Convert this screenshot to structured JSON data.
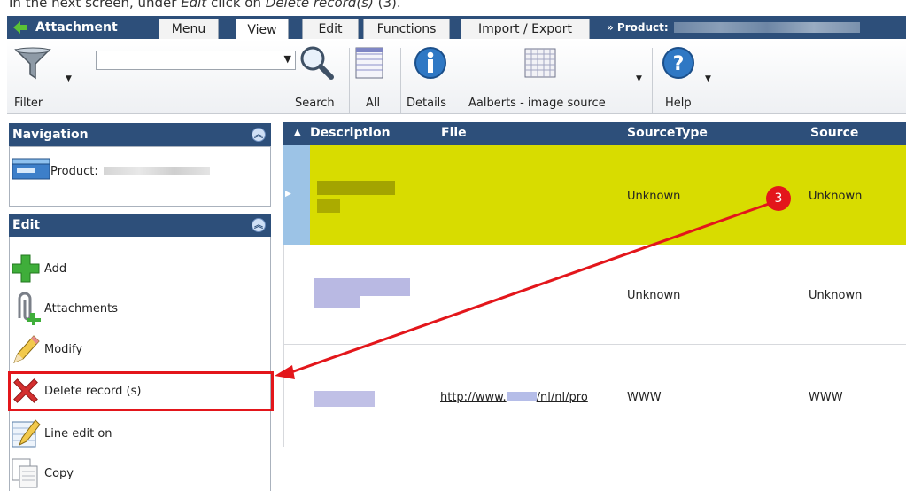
{
  "caption": {
    "prefix": "In the next screen, under ",
    "edit": "Edit",
    "mid": " click on ",
    "action": "Delete record(s)",
    "suffix": " (3)."
  },
  "tabs": {
    "app_label": "Attachment",
    "items": [
      "Menu",
      "View",
      "Edit",
      "Functions",
      "Import / Export"
    ],
    "breadcrumb": "» Product:"
  },
  "toolbar": {
    "filter_label": "Filter",
    "search_label": "Search",
    "all_label": "All",
    "details_label": "Details",
    "image_source_label": "Aalberts - image source",
    "help_label": "Help",
    "dropdown_value": ""
  },
  "navigation": {
    "title": "Navigation",
    "product_label": "Product:"
  },
  "edit_panel": {
    "title": "Edit",
    "items": [
      "Add",
      "Attachments",
      "Modify",
      "Delete record (s)",
      "Line edit on",
      "Copy"
    ]
  },
  "grid": {
    "columns": [
      "Description",
      "File",
      "SourceType",
      "Source"
    ],
    "rows": [
      {
        "file": "",
        "source_type": "Unknown",
        "source": "Unknown"
      },
      {
        "file": "",
        "source_type": "Unknown",
        "source": "Unknown"
      },
      {
        "file_a": "http://www.",
        "file_b": "/nl/nl/pro",
        "source_type": "WWW",
        "source": "WWW"
      }
    ]
  },
  "annotation": {
    "step": "3"
  },
  "colors": {
    "header": "#2d4f7a",
    "selected_row": "#d8dc00",
    "annotation": "#e3161b"
  }
}
